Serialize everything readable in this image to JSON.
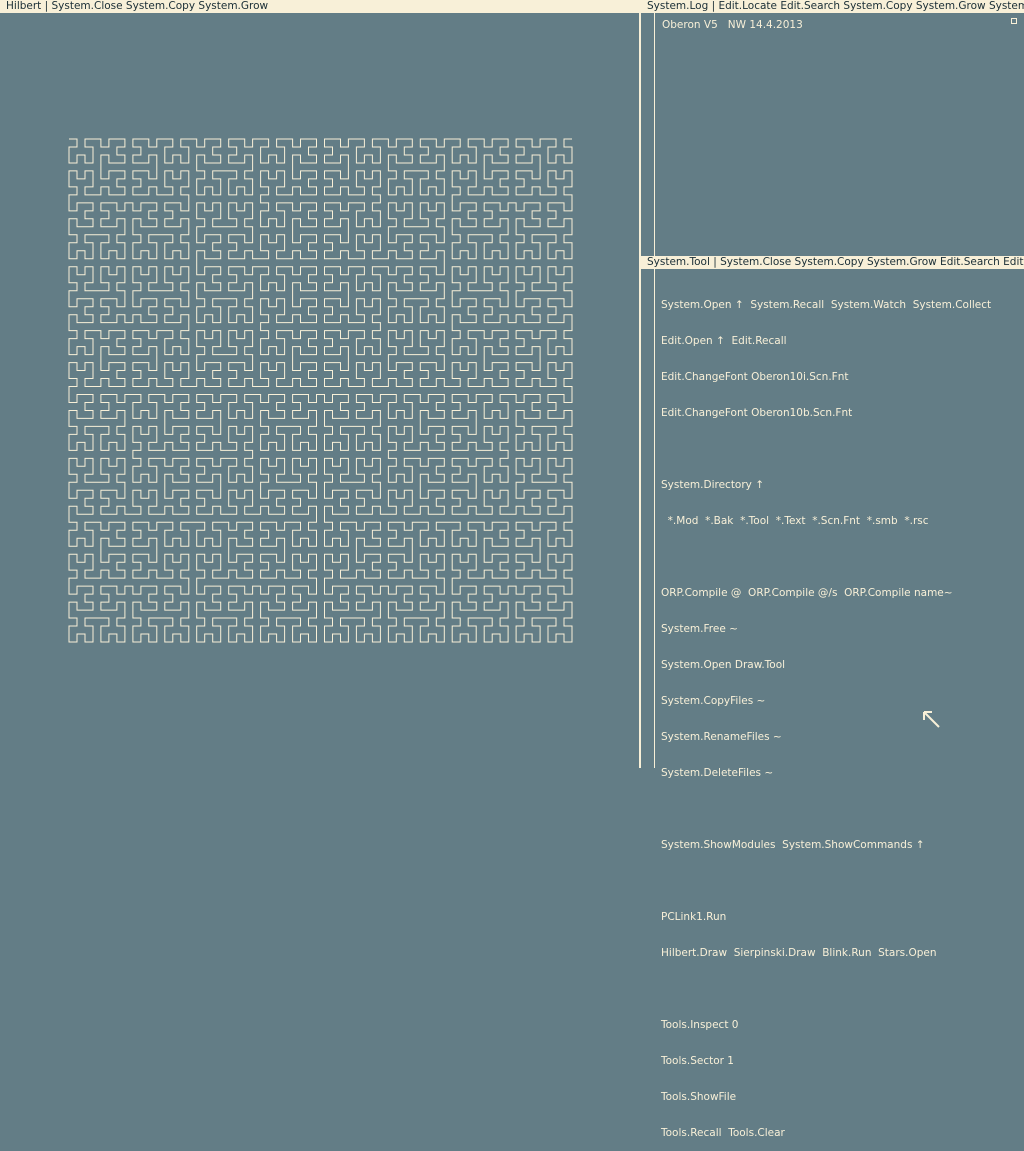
{
  "left_viewer": {
    "title_bar": "Hilbert | System.Close  System.Copy  System.Grow"
  },
  "log_viewer": {
    "title_bar": "System.Log | Edit.Locate Edit.Search System.Copy System.Grow System.Clear",
    "text": "Oberon V5   NW 14.4.2013"
  },
  "tool_viewer": {
    "title_bar": "System.Tool | System.Close System.Copy System.Grow Edit.Search Edit.Store",
    "lines": [
      "System.Open ↑  System.Recall  System.Watch  System.Collect",
      "Edit.Open ↑  Edit.Recall",
      "Edit.ChangeFont Oberon10i.Scn.Fnt",
      "Edit.ChangeFont Oberon10b.Scn.Fnt",
      "",
      "System.Directory ↑",
      "  *.Mod  *.Bak  *.Tool  *.Text  *.Scn.Fnt  *.smb  *.rsc",
      "",
      "ORP.Compile @  ORP.Compile @/s  ORP.Compile name~",
      "System.Free ~",
      "System.Open Draw.Tool",
      "System.CopyFiles ~",
      "System.RenameFiles ~",
      "System.DeleteFiles ~",
      "",
      "System.ShowModules  System.ShowCommands ↑",
      "",
      "PCLink1.Run",
      "Hilbert.Draw  Sierpinski.Draw  Blink.Run  Stars.Open",
      "",
      "Tools.Inspect 0",
      "Tools.Sector 1",
      "Tools.ShowFile",
      "Tools.Recall  Tools.Clear"
    ]
  },
  "icons": {
    "cursor": "arrow-cursor-icon",
    "viewer_marker": "square-marker-icon"
  },
  "colors": {
    "background": "#637d86",
    "foreground": "#f8f0d8",
    "bar_text": "#1a2e36"
  },
  "hilbert": {
    "order": 6
  }
}
